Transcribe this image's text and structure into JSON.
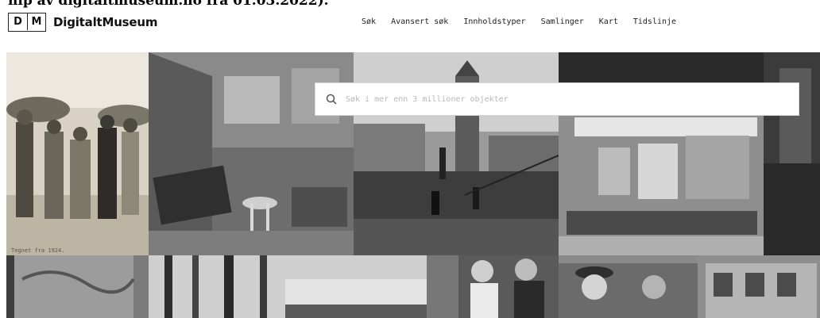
{
  "caption": "hip av digitaltmuseum.no fra 01.03.2022).",
  "header": {
    "logo": {
      "letter_1": "D",
      "letter_2": "M",
      "name": "DigitaltMuseum"
    },
    "nav": [
      {
        "label": "Søk"
      },
      {
        "label": "Avansert søk"
      },
      {
        "label": "Innholdstyper"
      },
      {
        "label": "Samlinger"
      },
      {
        "label": "Kart"
      },
      {
        "label": "Tidslinje"
      }
    ]
  },
  "search": {
    "placeholder": "Søk i mer enn 3 millioner objekter",
    "icon": "search-icon"
  },
  "photo_caption": "Tegnet fra 1924.",
  "colors": {
    "background": "#ffffff",
    "text": "#1a1a1a",
    "placeholder": "#b8b8b8",
    "border": "#d8d8d8"
  }
}
